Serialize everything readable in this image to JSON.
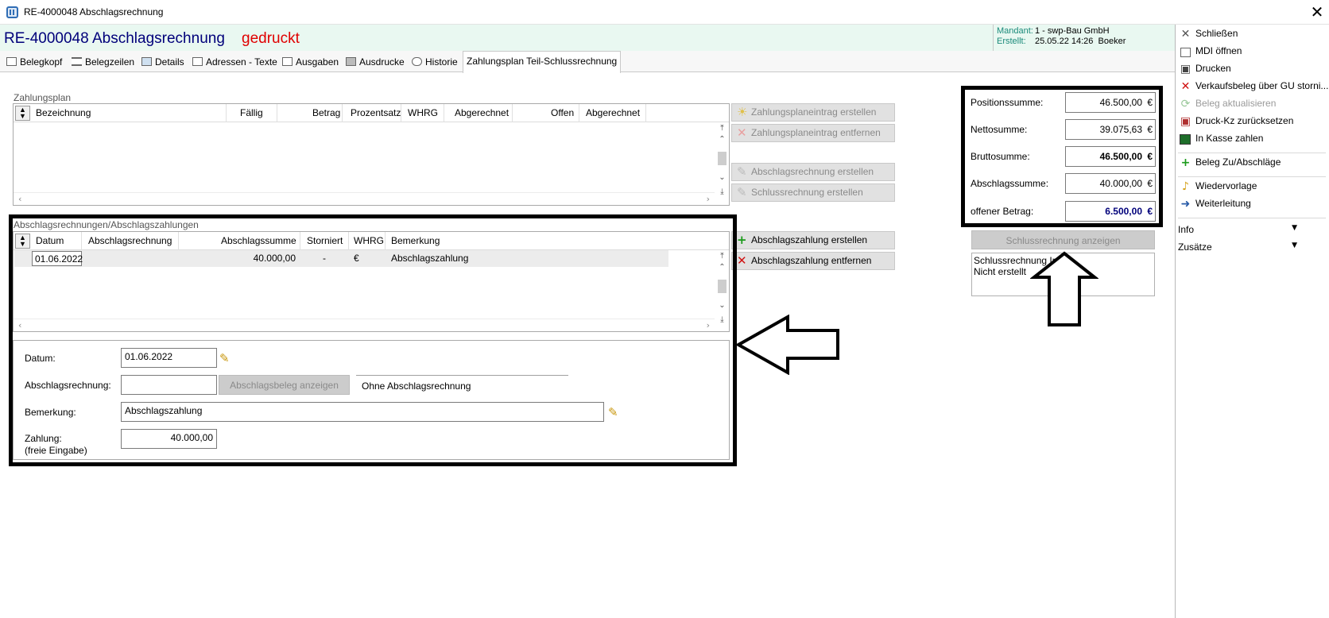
{
  "window": {
    "title": "RE-4000048 Abschlagsrechnung",
    "close_glyph": "✕"
  },
  "header": {
    "doc_number": "RE-4000048",
    "doc_type": "Abschlagsrechnung",
    "doc_status": "gedruckt",
    "mandant_label": "Mandant:",
    "mandant_value": "1 - swp-Bau GmbH",
    "erstellt_label": "Erstellt:",
    "erstellt_value": "25.05.22 14:26  Boeker"
  },
  "tabs": [
    {
      "label": "Belegkopf",
      "icon": "edit-doc-icon"
    },
    {
      "label": "Belegzeilen",
      "icon": "list-icon"
    },
    {
      "label": "Details",
      "icon": "details-icon"
    },
    {
      "label": "Adressen - Texte",
      "icon": "page-icon"
    },
    {
      "label": "Ausgaben",
      "icon": "output-icon"
    },
    {
      "label": "Ausdrucke",
      "icon": "printer-icon"
    },
    {
      "label": "Historie",
      "icon": "link-icon"
    },
    {
      "label": "Zahlungsplan Teil-Schlussrechnung",
      "icon": ""
    }
  ],
  "zahlungsplan": {
    "label": "Zahlungsplan",
    "columns": [
      "Bezeichnung",
      "Fällig",
      "Betrag",
      "Prozentsatz",
      "WHRG",
      "Abgerechnet",
      "Offen",
      "Abgerechnet"
    ],
    "actions": [
      {
        "label": "Zahlungsplaneintrag erstellen",
        "icon": "sun-icon",
        "enabled": false
      },
      {
        "label": "Zahlungsplaneintrag entfernen",
        "icon": "delete-x-icon",
        "enabled": false
      },
      {
        "label": "Abschlagsrechnung erstellen",
        "icon": "edit-doc-icon",
        "enabled": false
      },
      {
        "label": "Schlussrechnung erstellen",
        "icon": "edit-doc-icon",
        "enabled": false
      }
    ]
  },
  "abschlag": {
    "label": "Abschlagsrechnungen/Abschlagszahlungen",
    "columns": [
      "Datum",
      "Abschlagsrechnung",
      "Abschlagssumme",
      "Storniert",
      "WHRG",
      "Bemerkung"
    ],
    "rows": [
      {
        "datum": "01.06.2022",
        "rechnung": "",
        "summe": "40.000,00",
        "storniert": "-",
        "whrg": "€",
        "bemerkung": "Abschlagszahlung"
      }
    ],
    "actions": [
      {
        "label": "Abschlagszahlung erstellen",
        "icon": "plus-icon",
        "enabled": true
      },
      {
        "label": "Abschlagszahlung entfernen",
        "icon": "delete-x-icon",
        "enabled": true
      }
    ]
  },
  "detail": {
    "datum_label": "Datum:",
    "datum_value": "01.06.2022",
    "rechnung_label": "Abschlagsrechnung:",
    "rechnung_value": "",
    "show_beleg_button": "Abschlagsbeleg anzeigen",
    "ohne_text": "Ohne Abschlagsrechnung",
    "bemerkung_label": "Bemerkung:",
    "bemerkung_value": "Abschlagszahlung",
    "zahlung_label": "Zahlung:",
    "zahlung_sublabel": "(freie Eingabe)",
    "zahlung_value": "40.000,00"
  },
  "totals": {
    "currency": "€",
    "positionssumme_label": "Positionssumme:",
    "positionssumme": "46.500,00",
    "nettosumme_label": "Nettosumme:",
    "nettosumme": "39.075,63",
    "bruttosumme_label": "Bruttosumme:",
    "bruttosumme": "46.500,00",
    "abschlagssumme_label": "Abschlagssumme:",
    "abschlagssumme": "40.000,00",
    "offener_label": "offener Betrag:",
    "offener": "6.500,00",
    "schluss_button": "Schlussrechnung anzeigen",
    "info_line1": "Schlussrechnung Info:",
    "info_line2": "Nicht erstellt"
  },
  "right_panel": {
    "commands": [
      {
        "label": "Schließen",
        "icon": "close-x-icon",
        "enabled": true
      },
      {
        "label": "MDI öffnen",
        "icon": "window-icon",
        "enabled": true
      },
      {
        "label": "Drucken",
        "icon": "printer-icon",
        "enabled": true
      },
      {
        "label": "Verkaufsbeleg über GU storni...",
        "icon": "red-x-icon",
        "enabled": true
      },
      {
        "label": "Beleg aktualisieren",
        "icon": "refresh-icon",
        "enabled": false
      },
      {
        "label": "Druck-Kz zurücksetzen",
        "icon": "printer-reset-icon",
        "enabled": true
      },
      {
        "label": "In Kasse zahlen",
        "icon": "cash-register-icon",
        "enabled": true
      },
      {
        "label": "Beleg Zu/Abschläge",
        "icon": "plus-doc-icon",
        "enabled": true
      },
      {
        "label": "Wiedervorlage",
        "icon": "bell-icon",
        "enabled": true
      },
      {
        "label": "Weiterleitung",
        "icon": "forward-people-icon",
        "enabled": true
      }
    ],
    "info_expander": "Info",
    "zusaetze_expander": "Zusätze"
  },
  "colors": {
    "accent_blue": "#00007a",
    "status_red": "#e00000",
    "header_bg": "#e9f8f1"
  }
}
